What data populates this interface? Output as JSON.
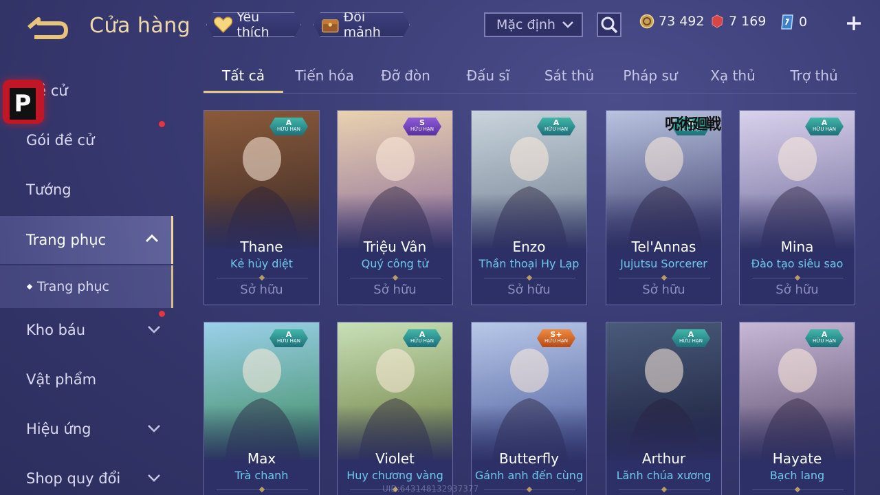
{
  "header": {
    "title": "Cửa hàng",
    "favorite_label": "Yêu thích",
    "shard_label": "Đổi mảnh",
    "sort_value": "Mặc định",
    "gold": "73 492",
    "ruby": "7 169",
    "voucher": "0"
  },
  "sidebar": {
    "items": [
      {
        "label": "Đề cử"
      },
      {
        "label": "Gói đề cử"
      },
      {
        "label": "Tướng"
      },
      {
        "label": "Trang phục"
      },
      {
        "label": "Trang phục"
      },
      {
        "label": "Kho báu"
      },
      {
        "label": "Vật phẩm"
      },
      {
        "label": "Hiệu ứng"
      },
      {
        "label": "Shop quy đổi"
      }
    ]
  },
  "tabs": [
    {
      "label": "Tất cả"
    },
    {
      "label": "Tiến hóa"
    },
    {
      "label": "Đỡ đòn"
    },
    {
      "label": "Đấu sĩ"
    },
    {
      "label": "Sát thủ"
    },
    {
      "label": "Pháp sư"
    },
    {
      "label": "Xạ thủ"
    },
    {
      "label": "Trợ thủ"
    }
  ],
  "cards": [
    {
      "hero": "Thane",
      "skin": "Kẻ hủy diệt",
      "status": "Sở hữu",
      "rank": "A",
      "limit": "HỮU HẠN",
      "colors": [
        "#8a5a3a",
        "#3b2a28"
      ]
    },
    {
      "hero": "Triệu Vân",
      "skin": "Quý công tử",
      "status": "Sở hữu",
      "rank": "S",
      "limit": "HỮU HẠN",
      "colors": [
        "#e9d2b0",
        "#8a6a9a"
      ]
    },
    {
      "hero": "Enzo",
      "skin": "Thần thoại Hy Lạp",
      "status": "Sở hữu",
      "rank": "A",
      "limit": "HỮU HẠN",
      "colors": [
        "#c9d4dc",
        "#6f7d8f"
      ]
    },
    {
      "hero": "Tel'Annas",
      "skin": "Jujutsu Sorcerer",
      "status": "Sở hữu",
      "rank": "A",
      "limit": "HỮU HẠN",
      "colors": [
        "#b9c4e0",
        "#3a3a6a"
      ],
      "logo": "呪術廻戦"
    },
    {
      "hero": "Mina",
      "skin": "Đào tạo siêu sao",
      "status": "Sở hữu",
      "rank": "A",
      "limit": "HỮU HẠN",
      "colors": [
        "#d9d2ec",
        "#6f6a9a"
      ]
    },
    {
      "hero": "Max",
      "skin": "Trà chanh",
      "status": "",
      "rank": "A",
      "limit": "HỮU HẠN",
      "colors": [
        "#9bd0ea",
        "#3a8a5a"
      ]
    },
    {
      "hero": "Violet",
      "skin": "Huy chương vàng",
      "status": "",
      "rank": "A",
      "limit": "HỮU HẠN",
      "colors": [
        "#c8e0b8",
        "#6a7a3a"
      ]
    },
    {
      "hero": "Butterfly",
      "skin": "Gánh anh đến cùng",
      "status": "",
      "rank": "S+",
      "limit": "HỮU HẠN",
      "colors": [
        "#b8c8e8",
        "#4a5a9a"
      ]
    },
    {
      "hero": "Arthur",
      "skin": "Lãnh chúa xương",
      "status": "",
      "rank": "A",
      "limit": "HỮU HẠN",
      "colors": [
        "#4a5a7a",
        "#1a1e3a"
      ]
    },
    {
      "hero": "Hayate",
      "skin": "Bạch lang",
      "status": "",
      "rank": "A",
      "limit": "HỮU HẠN",
      "colors": [
        "#c8b8d8",
        "#5a4a6a"
      ]
    }
  ],
  "footer": {
    "uid": "UID:643148132937377"
  }
}
